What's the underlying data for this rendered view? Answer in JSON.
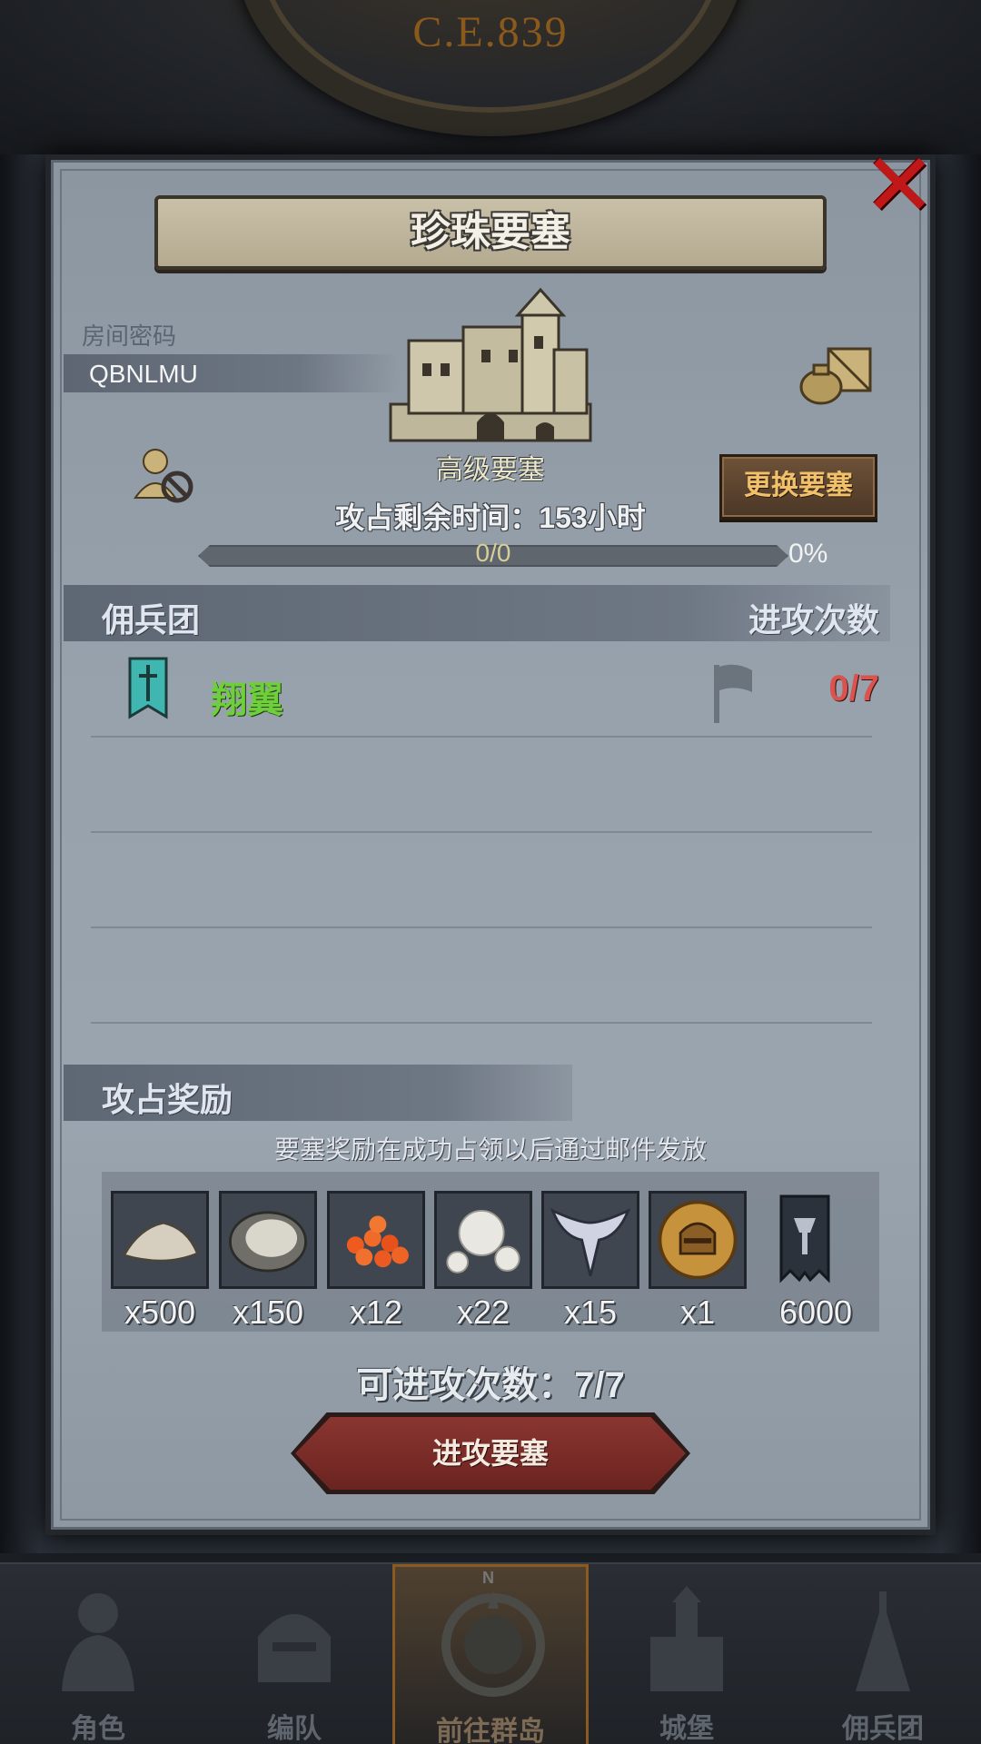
{
  "header": {
    "era": "C.E.839"
  },
  "dialog": {
    "title": "珍珠要塞",
    "room_label": "房间密码",
    "room_code": "QBNLMU",
    "fortress_type": "高级要塞",
    "change_button": "更换要塞",
    "timer_text": "攻占剩余时间：153小时",
    "progress": {
      "text": "0/0",
      "percent_text": "0%",
      "fraction": 0
    },
    "sections": {
      "mercenary": "佣兵团",
      "attack_count_header": "进攻次数",
      "rewards": "攻占奖励"
    },
    "mercenaries": [
      {
        "name": "翔翼",
        "attacks": "0/7"
      }
    ],
    "reward_note": "要塞奖励在成功占领以后通过邮件发放",
    "rewards": [
      {
        "icon": "stone-ore-icon",
        "qty": "x500"
      },
      {
        "icon": "oyster-icon",
        "qty": "x150"
      },
      {
        "icon": "fish-roe-icon",
        "qty": "x12"
      },
      {
        "icon": "pearls-icon",
        "qty": "x22"
      },
      {
        "icon": "wings-emblem-icon",
        "qty": "x15"
      },
      {
        "icon": "knight-helmet-coin-icon",
        "qty": "x1"
      },
      {
        "icon": "guild-banner-icon",
        "qty": "6000"
      }
    ],
    "attacks_available": "可进攻次数：7/7",
    "attack_button": "进攻要塞",
    "colors": {
      "accent_red": "#c01818",
      "merc_green": "#6fcf3a",
      "attack_count_red": "#d9534f"
    }
  },
  "nav": {
    "compass_letter": "N",
    "items": [
      {
        "label": "角色",
        "active": false
      },
      {
        "label": "编队",
        "active": false
      },
      {
        "label": "前往群岛",
        "active": true
      },
      {
        "label": "城堡",
        "active": false
      },
      {
        "label": "佣兵团",
        "active": false
      }
    ]
  }
}
